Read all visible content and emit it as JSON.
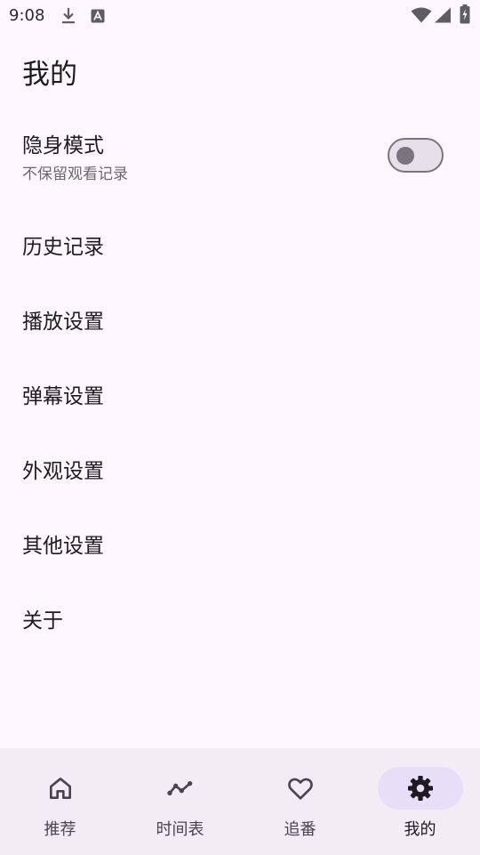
{
  "status_bar": {
    "time": "9:08",
    "icons": [
      "download-icon",
      "a-notification-icon",
      "wifi-icon",
      "signal-icon",
      "battery-charging-icon"
    ]
  },
  "page": {
    "title": "我的"
  },
  "incognito": {
    "title": "隐身模式",
    "subtitle": "不保留观看记录",
    "enabled": false
  },
  "menu": {
    "items": [
      {
        "label": "历史记录"
      },
      {
        "label": "播放设置"
      },
      {
        "label": "弹幕设置"
      },
      {
        "label": "外观设置"
      },
      {
        "label": "其他设置"
      },
      {
        "label": "关于"
      }
    ]
  },
  "bottom_nav": {
    "items": [
      {
        "label": "推荐",
        "icon": "home-icon",
        "active": false
      },
      {
        "label": "时间表",
        "icon": "timeline-icon",
        "active": false
      },
      {
        "label": "追番",
        "icon": "heart-icon",
        "active": false
      },
      {
        "label": "我的",
        "icon": "gear-icon",
        "active": true
      }
    ]
  },
  "colors": {
    "background": "#fdf7fd",
    "nav_background": "#f2ecf4",
    "active_indicator": "#e8def8",
    "text_primary": "#1d1b20",
    "text_secondary": "#6b6670"
  }
}
